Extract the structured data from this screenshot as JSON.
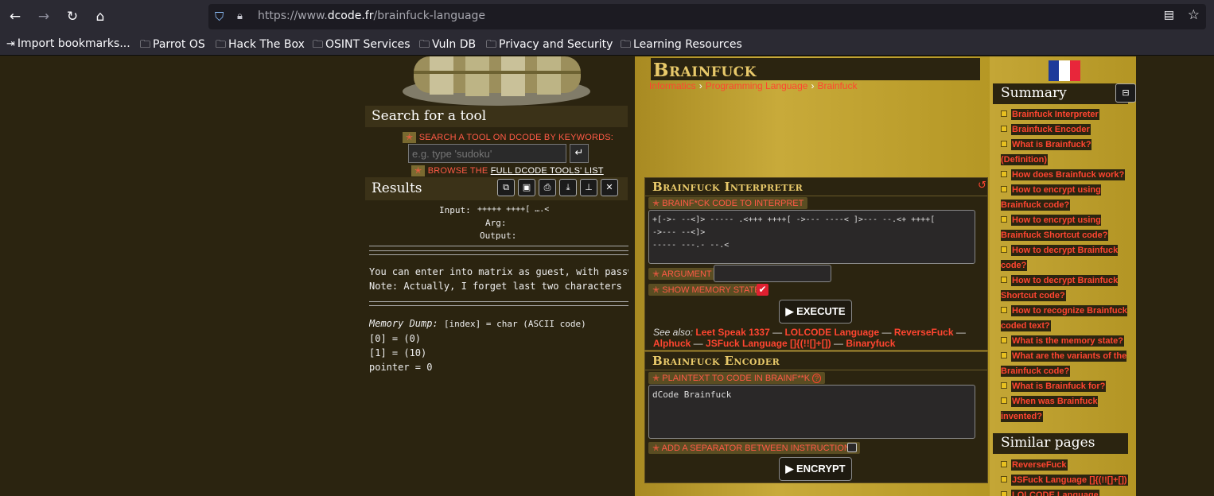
{
  "browser": {
    "url_prefix": "https://www.",
    "url_domain": "dcode.fr",
    "url_path": "/brainfuck-language"
  },
  "bookmarks": [
    {
      "label": "Import bookmarks...",
      "icon": "import-icon"
    },
    {
      "label": "Parrot OS",
      "icon": "folder-icon"
    },
    {
      "label": "Hack The Box",
      "icon": "folder-icon"
    },
    {
      "label": "OSINT Services",
      "icon": "folder-icon"
    },
    {
      "label": "Vuln DB",
      "icon": "folder-icon"
    },
    {
      "label": "Privacy and Security",
      "icon": "folder-icon"
    },
    {
      "label": "Learning Resources",
      "icon": "folder-icon"
    }
  ],
  "search": {
    "title": "Search for a tool",
    "keywords_label": "SEARCH A TOOL ON DCODE BY KEYWORDS:",
    "placeholder": "e.g. type 'sudoku'",
    "browse_label_a": "BROWSE THE ",
    "browse_label_b": "FULL DCODE TOOLS' LIST"
  },
  "results": {
    "title": "Results",
    "input_label": "Input:",
    "input_value": "+++++ ++++[ ….<",
    "arg_label": "Arg:",
    "output_label": "Output:",
    "message_line1": "You can enter into matrix as guest, with passw",
    "message_line2": "Note: Actually, I forget last two characters s",
    "memory_label": "Memory Dump:",
    "memory_format": "[index] = char (ASCII code)",
    "memory_rows": [
      "[0] =  (0)",
      "[1] =  (10)"
    ],
    "pointer": "pointer = 0"
  },
  "page": {
    "title": "Brainfuck",
    "breadcrumbs": [
      "Informatics",
      "Programming Language",
      "Brainfuck"
    ]
  },
  "interpreter": {
    "title": "Brainfuck Interpreter",
    "code_label": "BRAINF*CK CODE TO INTERPRET",
    "code_value": "+[->- --<]> ----- .<+++ ++++[ ->--- ----< ]>--- --.<+ ++++[\n->--- --<]>\n----- ---.- --.<",
    "argument_label": "ARGUMENT",
    "memory_state_label": "SHOW MEMORY STATE",
    "execute_label": "▶ EXECUTE",
    "see_also_label": "See also:",
    "see_also_links": [
      "Leet Speak 1337",
      "LOLCODE Language",
      "ReverseFuck",
      "Alphuck",
      "JSFuck Language []{(!![]+[])",
      "Binaryfuck"
    ]
  },
  "encoder": {
    "title": "Brainfuck Encoder",
    "plaintext_label": "PLAINTEXT TO CODE IN BRAINF**K",
    "plaintext_value": "dCode Brainfuck",
    "separator_label": "ADD A SEPARATOR BETWEEN INSTRUCTIONS",
    "encrypt_label": "▶ ENCRYPT"
  },
  "summary": {
    "title": "Summary",
    "items": [
      "Brainfuck Interpreter",
      "Brainfuck Encoder",
      "What is Brainfuck? (Definition)",
      "How does Brainfuck work?",
      "How to encrypt using Brainfuck code?",
      "How to encrypt using Brainfuck Shortcut code?",
      "How to decrypt Brainfuck code?",
      "How to decrypt Brainfuck Shortcut code?",
      "How to recognize Brainfuck coded text?",
      "What is the memory state?",
      "What are the variants of the Brainfuck code?",
      "What is Brainfuck for?",
      "When was Brainfuck invented?"
    ]
  },
  "similar": {
    "title": "Similar pages",
    "items": [
      "ReverseFuck",
      "JSFuck Language []{(!![]+[])",
      "LOLCODE Language"
    ]
  },
  "colors": {
    "accent_link": "#ff4530",
    "panel_bg": "#2b2410",
    "gold_bg": "#b89b2a"
  }
}
